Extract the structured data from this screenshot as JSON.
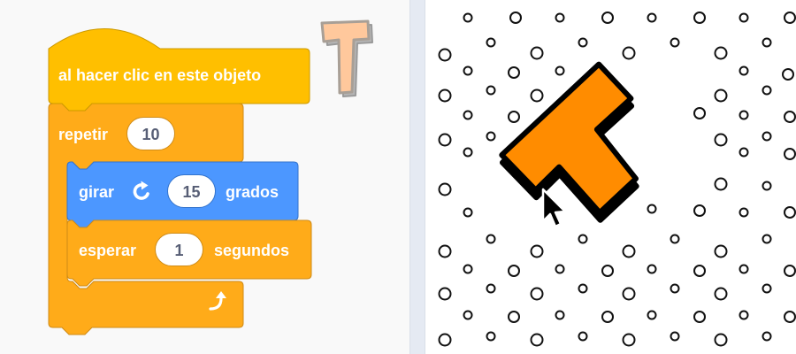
{
  "workspace": {
    "hat_block": {
      "label": "al hacer clic en este objeto"
    },
    "repeat_block": {
      "label": "repetir",
      "times": "10"
    },
    "turn_block": {
      "label_before": "girar",
      "degrees": "15",
      "label_after": "grados"
    },
    "wait_block": {
      "label_before": "esperar",
      "seconds": "1",
      "label_after": "segundos"
    },
    "icons": {
      "turn": "rotate-clockwise-icon",
      "loop": "loop-arrow-icon",
      "sprite_thumb": "letter-t-sprite-icon",
      "cursor": "mouse-pointer-icon"
    }
  },
  "colors": {
    "events": "#ffbf00",
    "control": "#ffab19",
    "motion": "#4c97ff",
    "sprite_fill": "#ff8c00"
  }
}
